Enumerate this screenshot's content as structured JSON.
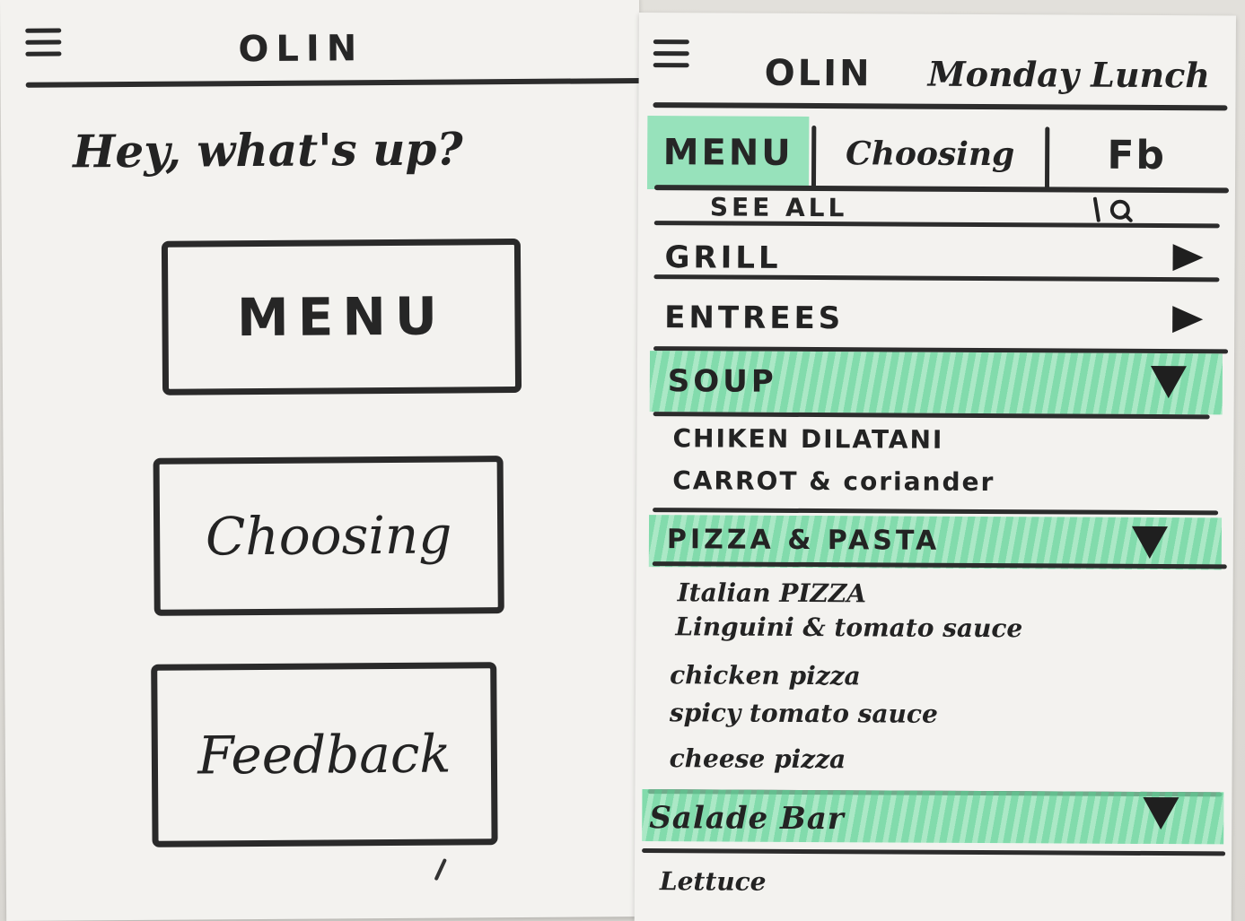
{
  "left_screen": {
    "app_title": "OLIN",
    "greeting": "Hey, what's up?",
    "buttons": {
      "menu": "MENU",
      "choosing": "Choosing",
      "feedback": "Feedback"
    },
    "icons": {
      "menu_icon": "hamburger-icon"
    }
  },
  "right_screen": {
    "app_title": "OLIN",
    "subtitle": "Monday Lunch",
    "tabs": [
      {
        "label": "MENU",
        "active": true
      },
      {
        "label": "Choosing",
        "active": false
      },
      {
        "label": "Fb",
        "active": false
      }
    ],
    "see_all": "SEE ALL",
    "search_icon": "search-icon",
    "categories": [
      {
        "label": "GRILL",
        "expanded": false,
        "items": []
      },
      {
        "label": "ENTREES",
        "expanded": false,
        "items": []
      },
      {
        "label": "SOUP",
        "expanded": true,
        "items": [
          "CHIKEN DILATANI",
          "CARROT & coriander"
        ]
      },
      {
        "label": "PIZZA & PASTA",
        "expanded": true,
        "items": [
          "Italian PIZZA",
          "Linguini & tomato sauce",
          "chicken pizza",
          "spicy tomato sauce",
          "cheese pizza"
        ]
      },
      {
        "label": "Salade Bar",
        "expanded": true,
        "items": [
          "Lettuce"
        ]
      }
    ],
    "colors": {
      "highlight": "#6ed7a0",
      "ink": "#2a2a2a",
      "paper": "#f3f2ef"
    }
  }
}
